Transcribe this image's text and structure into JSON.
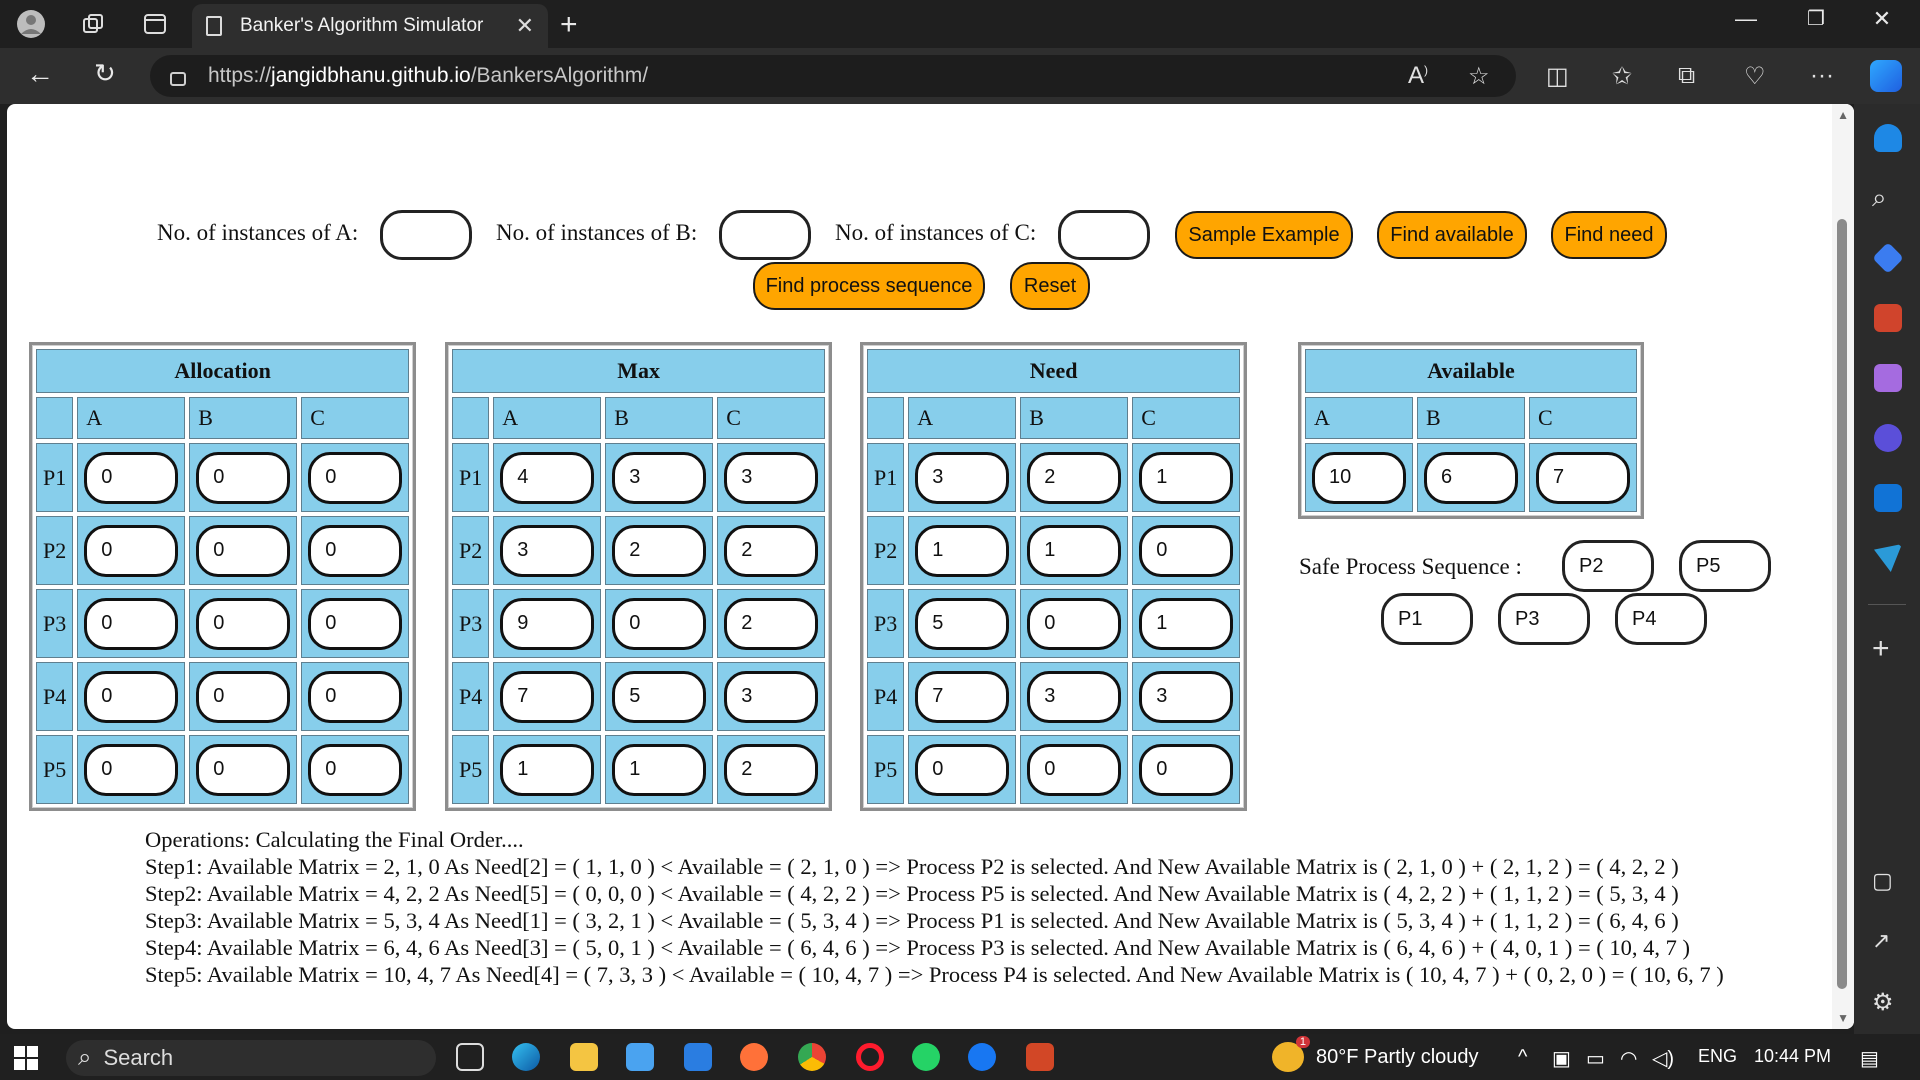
{
  "browser": {
    "tab_title": "Banker's Algorithm Simulator",
    "url_scheme": "https://",
    "url_domain": "jangidbhanu.github.io",
    "url_path": "/BankersAlgorithm/"
  },
  "controls": {
    "label_a": "No. of instances of A:",
    "label_b": "No. of instances of B:",
    "label_c": "No. of instances of C:",
    "btn_sample": "Sample Example",
    "btn_available": "Find available",
    "btn_need": "Find need",
    "btn_sequence": "Find process sequence",
    "btn_reset": "Reset"
  },
  "matrices": {
    "columns": [
      "A",
      "B",
      "C"
    ],
    "rows": [
      "P1",
      "P2",
      "P3",
      "P4",
      "P5"
    ],
    "allocation": {
      "title": "Allocation",
      "values": [
        [
          "0",
          "0",
          "0"
        ],
        [
          "0",
          "0",
          "0"
        ],
        [
          "0",
          "0",
          "0"
        ],
        [
          "0",
          "0",
          "0"
        ],
        [
          "0",
          "0",
          "0"
        ]
      ]
    },
    "max": {
      "title": "Max",
      "values": [
        [
          "4",
          "3",
          "3"
        ],
        [
          "3",
          "2",
          "2"
        ],
        [
          "9",
          "0",
          "2"
        ],
        [
          "7",
          "5",
          "3"
        ],
        [
          "1",
          "1",
          "2"
        ]
      ]
    },
    "need": {
      "title": "Need",
      "values": [
        [
          "3",
          "2",
          "1"
        ],
        [
          "1",
          "1",
          "0"
        ],
        [
          "5",
          "0",
          "1"
        ],
        [
          "7",
          "3",
          "3"
        ],
        [
          "0",
          "0",
          "0"
        ]
      ]
    },
    "available": {
      "title": "Available",
      "values": [
        "10",
        "6",
        "7"
      ]
    }
  },
  "safe_sequence": {
    "label": "Safe Process Sequence :",
    "items": [
      "P2",
      "P5",
      "P1",
      "P3",
      "P4"
    ]
  },
  "operations": {
    "header": "Operations:   Calculating the Final Order....",
    "steps": [
      "Step1:  Available Matrix = 2, 1, 0   As Need[2] = ( 1, 1, 0 ) < Available = ( 2, 1, 0 ) => Process P2 is selected. And New Available Matrix is ( 2, 1, 0 ) + ( 2, 1, 2 ) = ( 4, 2, 2 )",
      "Step2:  Available Matrix = 4, 2, 2   As Need[5] = ( 0, 0, 0 ) < Available = ( 4, 2, 2 ) => Process P5 is selected. And New Available Matrix is ( 4, 2, 2 ) + ( 1, 1, 2 ) = ( 5, 3, 4 )",
      "Step3:  Available Matrix = 5, 3, 4   As Need[1] = ( 3, 2, 1 ) < Available = ( 5, 3, 4 ) => Process P1 is selected. And New Available Matrix is ( 5, 3, 4 ) + ( 1, 1, 2 ) = ( 6, 4, 6 )",
      "Step4:  Available Matrix = 6, 4, 6   As Need[3] = ( 5, 0, 1 ) < Available = ( 6, 4, 6 ) => Process P3 is selected. And New Available Matrix is ( 6, 4, 6 ) + ( 4, 0, 1 ) = ( 10, 4, 7 )",
      "Step5:  Available Matrix = 10, 4, 7   As Need[4] = ( 7, 3, 3 ) < Available = ( 10, 4, 7 ) => Process P4 is selected. And New Available Matrix is ( 10, 4, 7 ) + ( 0, 2, 0 ) = ( 10, 6, 7 )"
    ]
  },
  "taskbar": {
    "search_placeholder": "Search",
    "weather": "80°F  Partly cloudy",
    "language": "ENG",
    "time": "10:44 PM",
    "notification_count": "1"
  },
  "colors": {
    "button": "#ffa500",
    "matrix_cell": "#87ceeb"
  }
}
